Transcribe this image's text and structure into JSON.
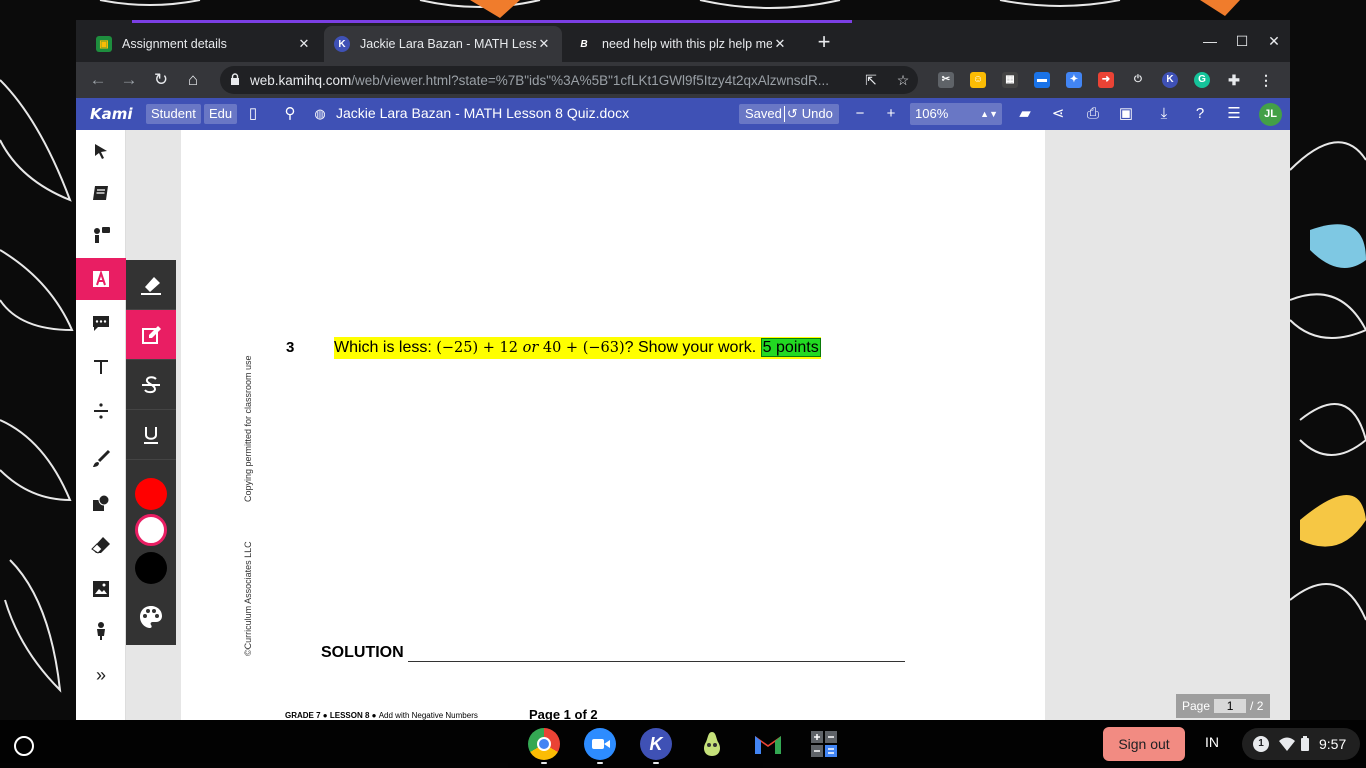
{
  "browser": {
    "tabs": [
      {
        "title": "Assignment details",
        "active": false
      },
      {
        "title": "Jackie Lara Bazan - MATH Lesso",
        "active": true
      },
      {
        "title": "need help with this plz help me -",
        "active": false
      }
    ],
    "url_host": "web.kamihq.com",
    "url_rest": "/web/viewer.html?state=%7B\"ids\"%3A%5B\"1cfLKt1GWl9f5Itzy4t2qxAlzwnsdR..."
  },
  "kami": {
    "logo": "Kami",
    "role_label": "Student",
    "edition_label": "Edu",
    "document_title": "Jackie Lara Bazan - MATH Lesson 8 Quiz.docx",
    "saved_label": "Saved",
    "undo_label": "Undo",
    "zoom_value": "106%",
    "avatar_initials": "JL",
    "colors": {
      "header": "#3f51b5",
      "accent": "#e91e63"
    },
    "swatches": [
      "#ff0000",
      "#ffffff",
      "#000000"
    ]
  },
  "document": {
    "question_number": "3",
    "question_prefix": "Which is less: ",
    "math_part1": "(−25) + 12 ",
    "math_or": "or",
    "math_part2": " 40 + (−63)",
    "question_suffix": "? Show your work. ",
    "points_label": "5 points",
    "side_note_1": "Copying permitted for classroom use",
    "side_note_2": "©Curriculum Associates LLC",
    "solution_label": "SOLUTION",
    "footer_grade": "GRADE 7",
    "footer_lesson": "LESSON 8",
    "footer_topic": "Add with Negative Numbers",
    "footer_page": "Page 1 of 2"
  },
  "page_indicator": {
    "label": "Page",
    "current": "1",
    "total": "/ 2"
  },
  "shelf": {
    "sign_out_label": "Sign out",
    "ime_label": "IN",
    "notification_count": "1",
    "time": "9:57"
  }
}
